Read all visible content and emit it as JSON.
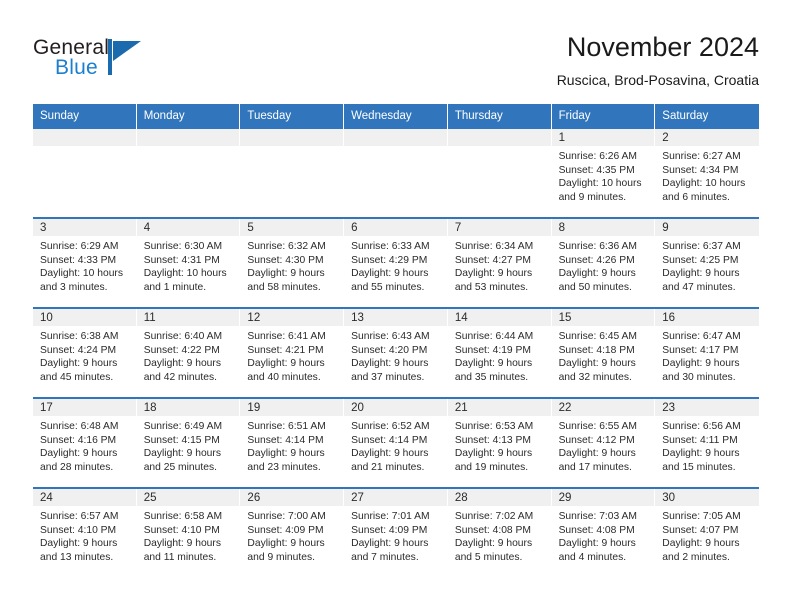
{
  "logo": {
    "word_one": "General",
    "word_two": "Blue",
    "mark": "triangle-mark"
  },
  "header": {
    "month_title": "November 2024",
    "location": "Ruscica, Brod-Posavina, Croatia"
  },
  "calendar": {
    "weekdays": [
      "Sunday",
      "Monday",
      "Tuesday",
      "Wednesday",
      "Thursday",
      "Friday",
      "Saturday"
    ],
    "labels": {
      "sunrise": "Sunrise:",
      "sunset": "Sunset:",
      "daylight": "Daylight:"
    },
    "weeks": [
      [
        {
          "day": "",
          "empty": true
        },
        {
          "day": "",
          "empty": true
        },
        {
          "day": "",
          "empty": true
        },
        {
          "day": "",
          "empty": true
        },
        {
          "day": "",
          "empty": true
        },
        {
          "day": "1",
          "sunrise": "Sunrise: 6:26 AM",
          "sunset": "Sunset: 4:35 PM",
          "daylight": "Daylight: 10 hours and 9 minutes."
        },
        {
          "day": "2",
          "sunrise": "Sunrise: 6:27 AM",
          "sunset": "Sunset: 4:34 PM",
          "daylight": "Daylight: 10 hours and 6 minutes."
        }
      ],
      [
        {
          "day": "3",
          "sunrise": "Sunrise: 6:29 AM",
          "sunset": "Sunset: 4:33 PM",
          "daylight": "Daylight: 10 hours and 3 minutes."
        },
        {
          "day": "4",
          "sunrise": "Sunrise: 6:30 AM",
          "sunset": "Sunset: 4:31 PM",
          "daylight": "Daylight: 10 hours and 1 minute."
        },
        {
          "day": "5",
          "sunrise": "Sunrise: 6:32 AM",
          "sunset": "Sunset: 4:30 PM",
          "daylight": "Daylight: 9 hours and 58 minutes."
        },
        {
          "day": "6",
          "sunrise": "Sunrise: 6:33 AM",
          "sunset": "Sunset: 4:29 PM",
          "daylight": "Daylight: 9 hours and 55 minutes."
        },
        {
          "day": "7",
          "sunrise": "Sunrise: 6:34 AM",
          "sunset": "Sunset: 4:27 PM",
          "daylight": "Daylight: 9 hours and 53 minutes."
        },
        {
          "day": "8",
          "sunrise": "Sunrise: 6:36 AM",
          "sunset": "Sunset: 4:26 PM",
          "daylight": "Daylight: 9 hours and 50 minutes."
        },
        {
          "day": "9",
          "sunrise": "Sunrise: 6:37 AM",
          "sunset": "Sunset: 4:25 PM",
          "daylight": "Daylight: 9 hours and 47 minutes."
        }
      ],
      [
        {
          "day": "10",
          "sunrise": "Sunrise: 6:38 AM",
          "sunset": "Sunset: 4:24 PM",
          "daylight": "Daylight: 9 hours and 45 minutes."
        },
        {
          "day": "11",
          "sunrise": "Sunrise: 6:40 AM",
          "sunset": "Sunset: 4:22 PM",
          "daylight": "Daylight: 9 hours and 42 minutes."
        },
        {
          "day": "12",
          "sunrise": "Sunrise: 6:41 AM",
          "sunset": "Sunset: 4:21 PM",
          "daylight": "Daylight: 9 hours and 40 minutes."
        },
        {
          "day": "13",
          "sunrise": "Sunrise: 6:43 AM",
          "sunset": "Sunset: 4:20 PM",
          "daylight": "Daylight: 9 hours and 37 minutes."
        },
        {
          "day": "14",
          "sunrise": "Sunrise: 6:44 AM",
          "sunset": "Sunset: 4:19 PM",
          "daylight": "Daylight: 9 hours and 35 minutes."
        },
        {
          "day": "15",
          "sunrise": "Sunrise: 6:45 AM",
          "sunset": "Sunset: 4:18 PM",
          "daylight": "Daylight: 9 hours and 32 minutes."
        },
        {
          "day": "16",
          "sunrise": "Sunrise: 6:47 AM",
          "sunset": "Sunset: 4:17 PM",
          "daylight": "Daylight: 9 hours and 30 minutes."
        }
      ],
      [
        {
          "day": "17",
          "sunrise": "Sunrise: 6:48 AM",
          "sunset": "Sunset: 4:16 PM",
          "daylight": "Daylight: 9 hours and 28 minutes."
        },
        {
          "day": "18",
          "sunrise": "Sunrise: 6:49 AM",
          "sunset": "Sunset: 4:15 PM",
          "daylight": "Daylight: 9 hours and 25 minutes."
        },
        {
          "day": "19",
          "sunrise": "Sunrise: 6:51 AM",
          "sunset": "Sunset: 4:14 PM",
          "daylight": "Daylight: 9 hours and 23 minutes."
        },
        {
          "day": "20",
          "sunrise": "Sunrise: 6:52 AM",
          "sunset": "Sunset: 4:14 PM",
          "daylight": "Daylight: 9 hours and 21 minutes."
        },
        {
          "day": "21",
          "sunrise": "Sunrise: 6:53 AM",
          "sunset": "Sunset: 4:13 PM",
          "daylight": "Daylight: 9 hours and 19 minutes."
        },
        {
          "day": "22",
          "sunrise": "Sunrise: 6:55 AM",
          "sunset": "Sunset: 4:12 PM",
          "daylight": "Daylight: 9 hours and 17 minutes."
        },
        {
          "day": "23",
          "sunrise": "Sunrise: 6:56 AM",
          "sunset": "Sunset: 4:11 PM",
          "daylight": "Daylight: 9 hours and 15 minutes."
        }
      ],
      [
        {
          "day": "24",
          "sunrise": "Sunrise: 6:57 AM",
          "sunset": "Sunset: 4:10 PM",
          "daylight": "Daylight: 9 hours and 13 minutes."
        },
        {
          "day": "25",
          "sunrise": "Sunrise: 6:58 AM",
          "sunset": "Sunset: 4:10 PM",
          "daylight": "Daylight: 9 hours and 11 minutes."
        },
        {
          "day": "26",
          "sunrise": "Sunrise: 7:00 AM",
          "sunset": "Sunset: 4:09 PM",
          "daylight": "Daylight: 9 hours and 9 minutes."
        },
        {
          "day": "27",
          "sunrise": "Sunrise: 7:01 AM",
          "sunset": "Sunset: 4:09 PM",
          "daylight": "Daylight: 9 hours and 7 minutes."
        },
        {
          "day": "28",
          "sunrise": "Sunrise: 7:02 AM",
          "sunset": "Sunset: 4:08 PM",
          "daylight": "Daylight: 9 hours and 5 minutes."
        },
        {
          "day": "29",
          "sunrise": "Sunrise: 7:03 AM",
          "sunset": "Sunset: 4:08 PM",
          "daylight": "Daylight: 9 hours and 4 minutes."
        },
        {
          "day": "30",
          "sunrise": "Sunrise: 7:05 AM",
          "sunset": "Sunset: 4:07 PM",
          "daylight": "Daylight: 9 hours and 2 minutes."
        }
      ]
    ]
  },
  "colors": {
    "header_blue": "#3176bc",
    "day_band_gray": "#f0f0f0",
    "logo_blue": "#1b7fd1",
    "text": "#2b2b2b"
  }
}
